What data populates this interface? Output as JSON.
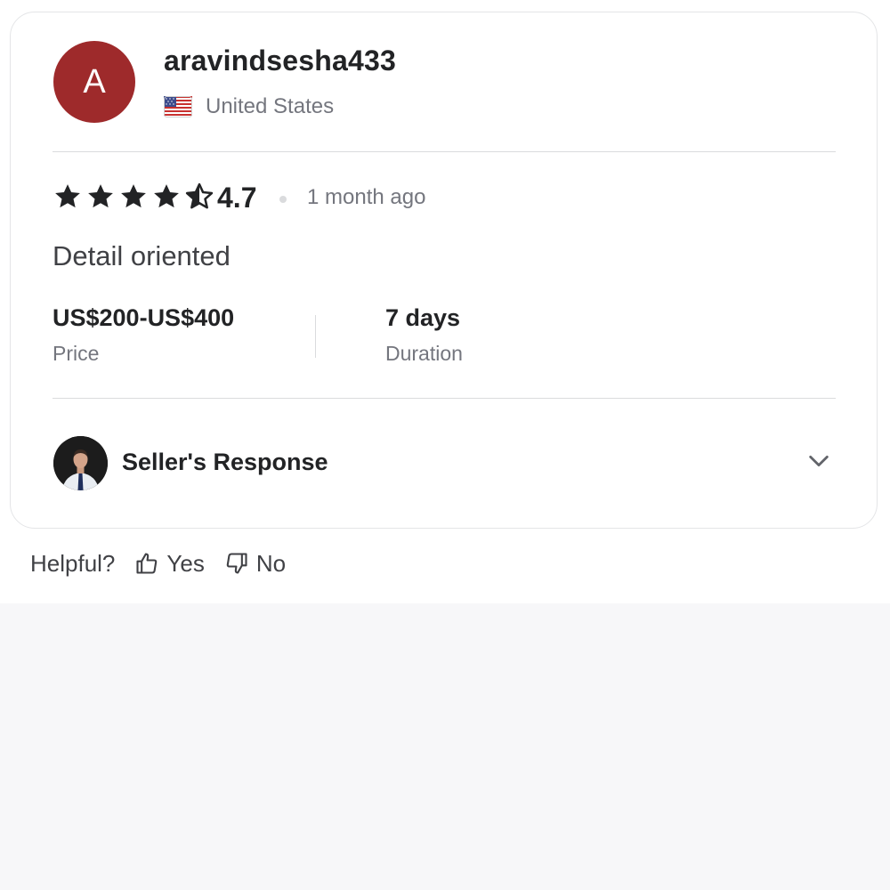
{
  "reviewer": {
    "avatar_initial": "A",
    "avatar_color": "#9e2a2b",
    "username": "aravindsesha433",
    "country": "United States",
    "flag_icon": "us-flag-icon"
  },
  "review": {
    "rating": 4.5,
    "rating_label": "4.7",
    "time_ago": "1 month ago",
    "text": "Detail oriented",
    "star_color": "#222325"
  },
  "details": {
    "price_value": "US$200-US$400",
    "price_label": "Price",
    "duration_value": "7 days",
    "duration_label": "Duration"
  },
  "seller_response": {
    "title": "Seller's Response",
    "expand_icon": "chevron-down-icon"
  },
  "helpful": {
    "label": "Helpful?",
    "yes_label": "Yes",
    "no_label": "No",
    "yes_icon": "thumbs-up-icon",
    "no_icon": "thumbs-down-icon"
  }
}
